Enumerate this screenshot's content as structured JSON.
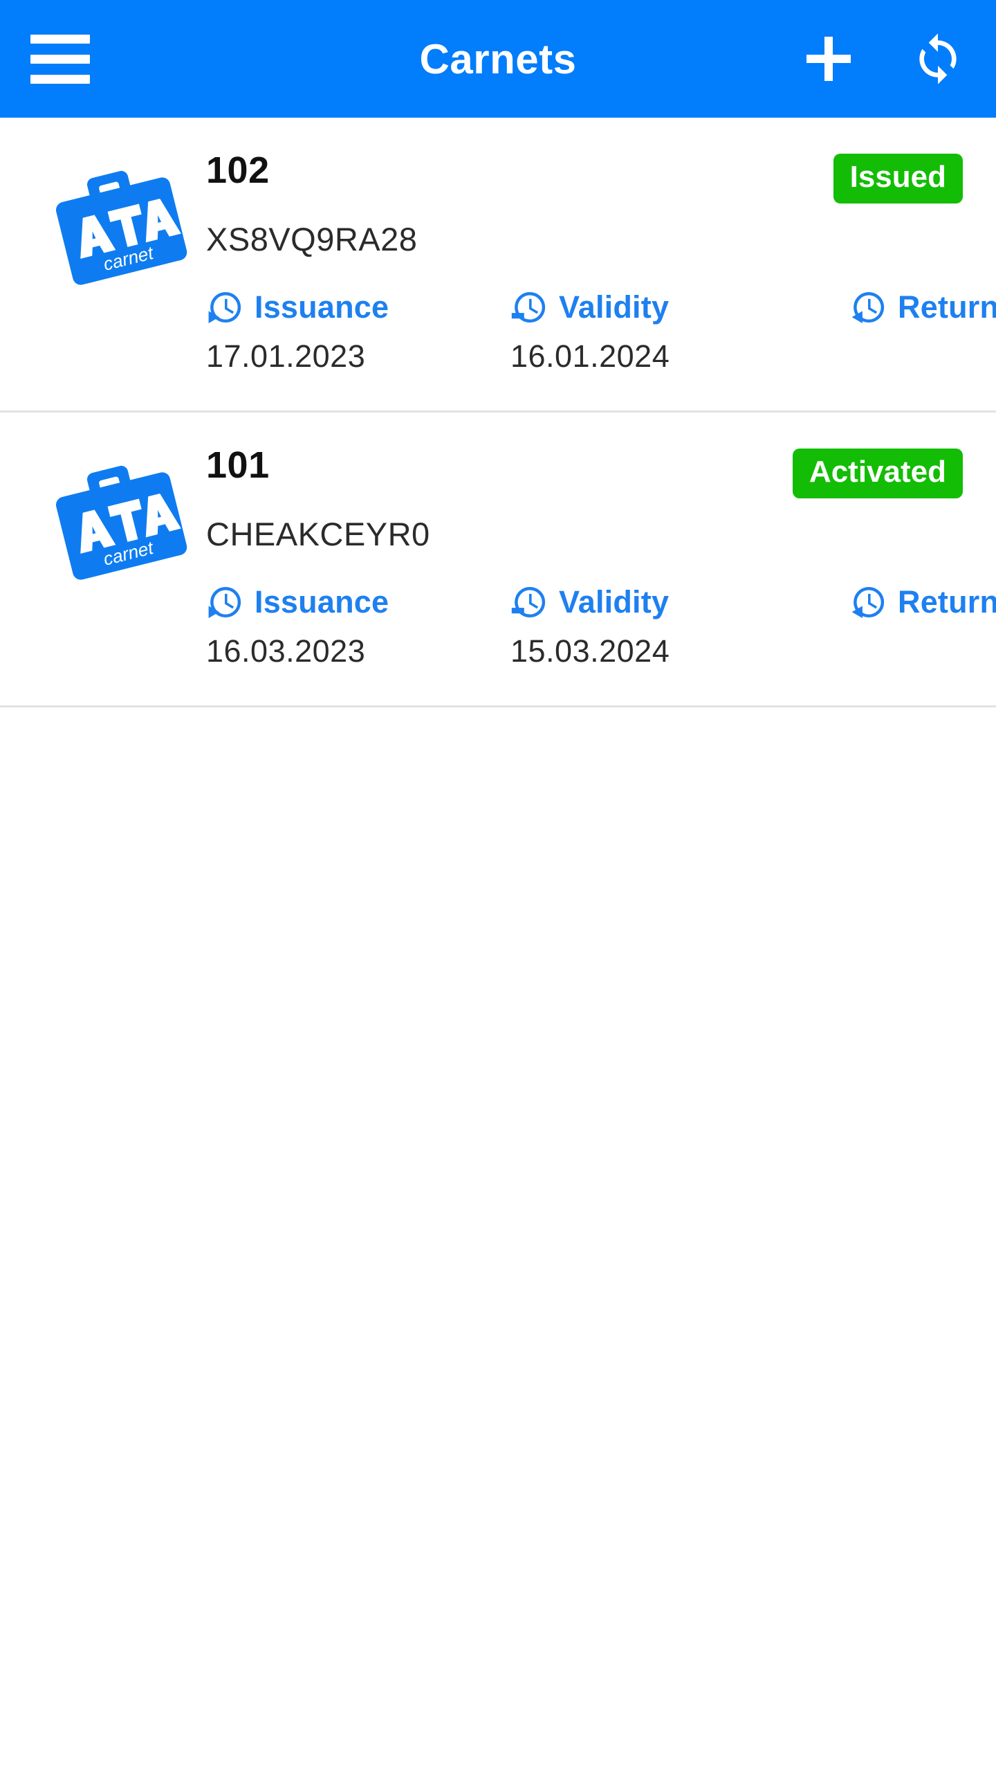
{
  "appbar": {
    "menu_icon": "hamburger-menu-icon",
    "title": "Carnets",
    "add_icon": "plus-icon",
    "sync_icon": "sync-refresh-icon",
    "background_color": "#027DFB"
  },
  "logo": {
    "primary_text": "ATA",
    "secondary_text": "carnet",
    "color": "#0E7CF0"
  },
  "labels": {
    "issuance": "Issuance",
    "validity": "Validity",
    "return": "Return"
  },
  "colors": {
    "accent_blue": "#027DFB",
    "label_blue": "#1E80F0",
    "status_green": "#13BD05",
    "divider": "#e2e2e2"
  },
  "carnets": [
    {
      "number": "102",
      "code": "XS8VQ9RA28",
      "status": "Issued",
      "issuance_date": "17.01.2023",
      "validity_date": "16.01.2024",
      "return_date": ""
    },
    {
      "number": "101",
      "code": "CHEAKCEYR0",
      "status": "Activated",
      "issuance_date": "16.03.2023",
      "validity_date": "15.03.2024",
      "return_date": ""
    }
  ]
}
